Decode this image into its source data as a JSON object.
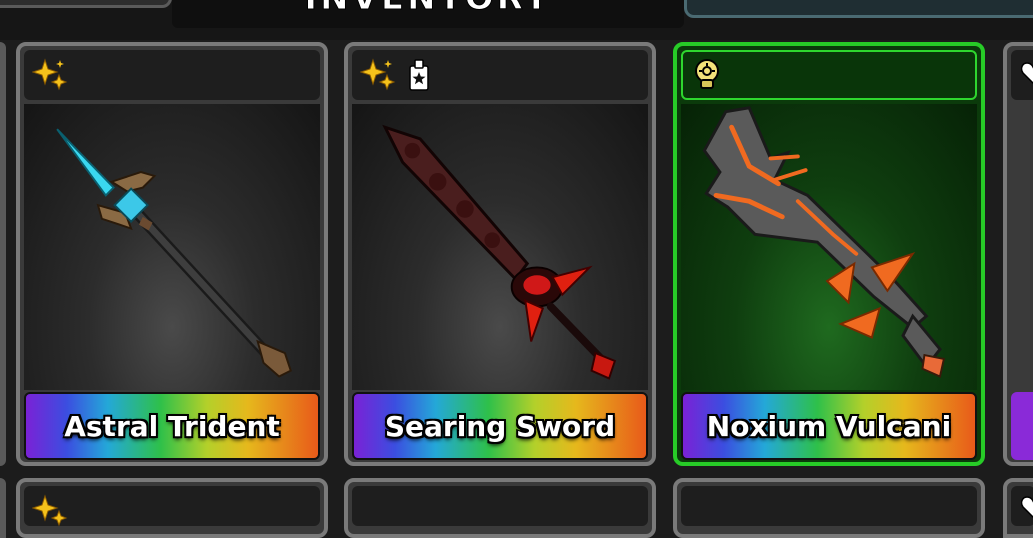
{
  "header": {
    "title": "INVENTORY"
  },
  "items": [
    {
      "name": "Astral Trident",
      "badges": [
        "sparkles-icon"
      ],
      "selected": false
    },
    {
      "name": "Searing Sword",
      "badges": [
        "sparkles-icon",
        "star-tag-icon"
      ],
      "selected": false
    },
    {
      "name": "Noxium Vulcani",
      "badges": [
        "lightbulb-icon"
      ],
      "selected": true
    }
  ],
  "partial_items": [
    {
      "badges": [
        "heart-icon"
      ]
    }
  ],
  "colors": {
    "selected_border": "#27cc27",
    "card_border": "#7a7a7a",
    "rainbow": [
      "#7a22d6",
      "#3b4ee0",
      "#24a8d8",
      "#2ec04a",
      "#b4d02a",
      "#e6b81c",
      "#e85a1a"
    ]
  }
}
